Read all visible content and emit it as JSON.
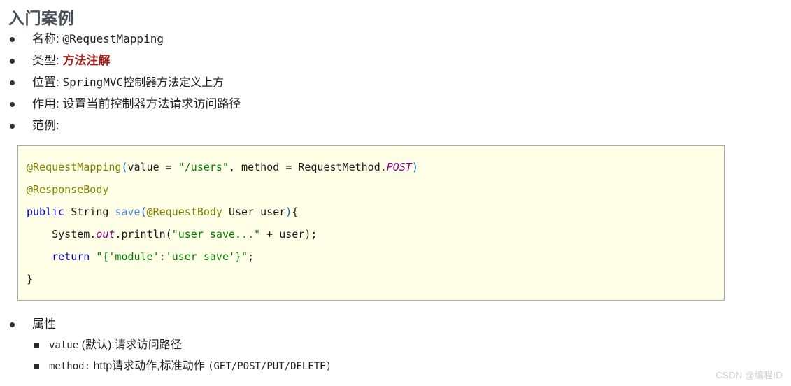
{
  "page": {
    "title": "入门案例",
    "background": "#ffffff",
    "title_color": "#48515a"
  },
  "bullets": [
    {
      "label": "名称:",
      "value": "@RequestMapping",
      "value_style": "mono"
    },
    {
      "label": "类型:",
      "value": "方法注解",
      "value_style": "emph-red"
    },
    {
      "label": "位置:",
      "value": "SpringMVC控制器方法定义上方",
      "value_style": "mono-mixed"
    },
    {
      "label": "作用:",
      "value": "设置当前控制器方法请求访问路径",
      "value_style": "cn"
    },
    {
      "label": "范例:",
      "value": "",
      "value_style": "cn"
    }
  ],
  "code_block": {
    "background": "#ffffe8",
    "border_color": "#a9a9a9",
    "lines": [
      {
        "tokens": [
          {
            "t": "@RequestMapping",
            "c": "tok-anno"
          },
          {
            "t": "(",
            "c": "tok-punc"
          },
          {
            "t": "value = ",
            "c": "tok-plain"
          },
          {
            "t": "\"/users\"",
            "c": "tok-str"
          },
          {
            "t": ", method = RequestMethod.",
            "c": "tok-plain"
          },
          {
            "t": "POST",
            "c": "tok-const"
          },
          {
            "t": ")",
            "c": "tok-punc"
          }
        ]
      },
      {
        "tokens": [
          {
            "t": "@ResponseBody",
            "c": "tok-anno"
          }
        ]
      },
      {
        "tokens": [
          {
            "t": "public",
            "c": "tok-kw"
          },
          {
            "t": " String ",
            "c": "tok-plain"
          },
          {
            "t": "save",
            "c": "tok-fn"
          },
          {
            "t": "(",
            "c": "tok-punc"
          },
          {
            "t": "@RequestBody",
            "c": "tok-anno"
          },
          {
            "t": " User user",
            "c": "tok-plain"
          },
          {
            "t": ")",
            "c": "tok-punc"
          },
          {
            "t": "{",
            "c": "tok-plain"
          }
        ]
      },
      {
        "tokens": [
          {
            "t": "    System.",
            "c": "tok-plain"
          },
          {
            "t": "out",
            "c": "tok-field"
          },
          {
            "t": ".println(",
            "c": "tok-plain"
          },
          {
            "t": "\"user save...\"",
            "c": "tok-str"
          },
          {
            "t": " + user);",
            "c": "tok-plain"
          }
        ]
      },
      {
        "tokens": [
          {
            "t": "    ",
            "c": "tok-plain"
          },
          {
            "t": "return",
            "c": "tok-kw"
          },
          {
            "t": " ",
            "c": "tok-plain"
          },
          {
            "t": "\"{'module':'user save'}\"",
            "c": "tok-str"
          },
          {
            "t": ";",
            "c": "tok-plain"
          }
        ]
      },
      {
        "tokens": [
          {
            "t": "}",
            "c": "tok-plain"
          }
        ]
      }
    ]
  },
  "attributes": {
    "heading": "属性",
    "items": [
      {
        "name": "value",
        "rest": "(默认):请求访问路径"
      },
      {
        "name": "method:",
        "rest": "http请求动作,标准动作",
        "tail": "(GET/POST/PUT/DELETE)"
      }
    ]
  },
  "watermark": "CSDN @编程ID"
}
